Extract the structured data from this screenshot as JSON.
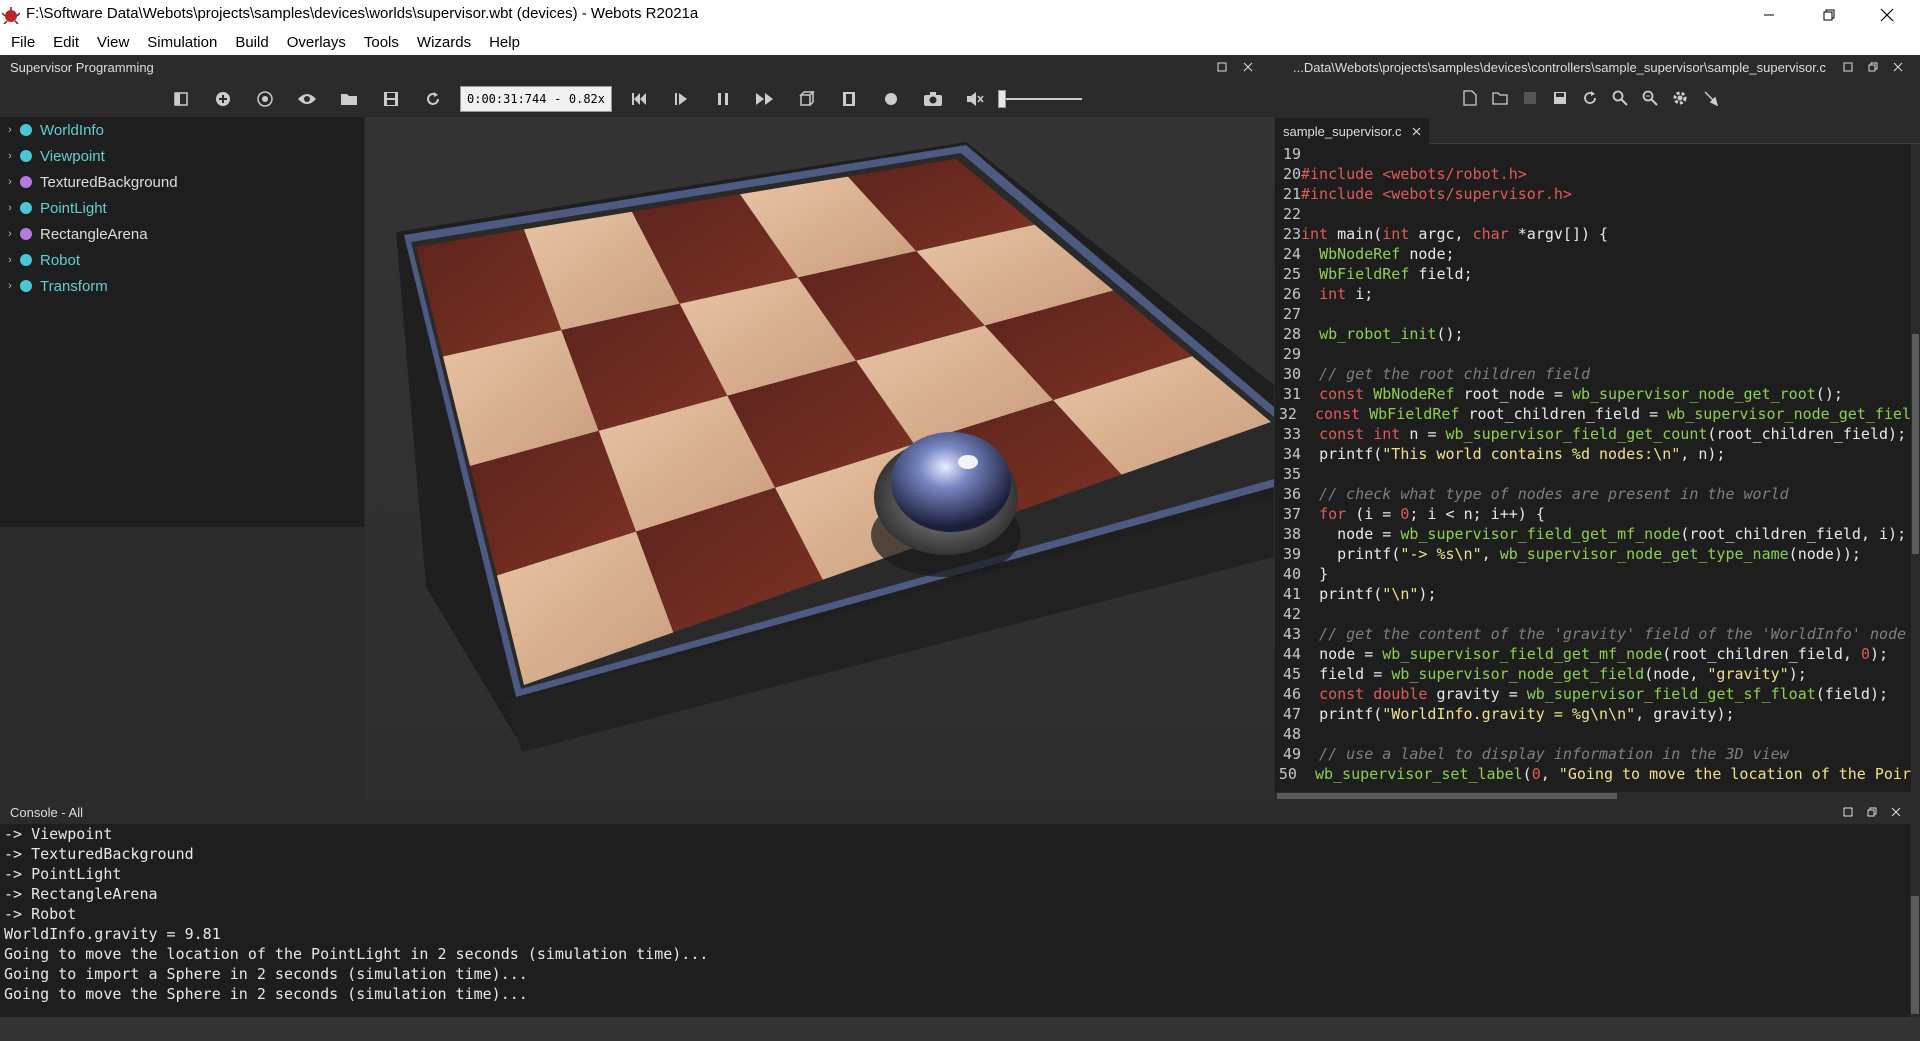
{
  "window": {
    "title": "F:\\Software Data\\Webots\\projects\\samples\\devices\\worlds\\supervisor.wbt (devices) - Webots R2021a",
    "minimize_icon": "minimize-icon",
    "maximize_icon": "restore-icon",
    "close_icon": "close-icon"
  },
  "menu": [
    "File",
    "Edit",
    "View",
    "Simulation",
    "Build",
    "Overlays",
    "Tools",
    "Wizards",
    "Help"
  ],
  "scene_panel": {
    "title": "Supervisor Programming",
    "sim_time": "0:00:31:744",
    "sim_speed": "0.82x",
    "tree": [
      {
        "label": "WorldInfo",
        "color": "#49c6d8",
        "text_color": "#5fd0d0"
      },
      {
        "label": "Viewpoint",
        "color": "#49c6d8",
        "text_color": "#5fd0d0"
      },
      {
        "label": "TexturedBackground",
        "color": "#b57be0",
        "text_color": "#dddddd"
      },
      {
        "label": "PointLight",
        "color": "#49c6d8",
        "text_color": "#5fd0d0"
      },
      {
        "label": "RectangleArena",
        "color": "#b57be0",
        "text_color": "#dddddd"
      },
      {
        "label": "Robot",
        "color": "#49c6d8",
        "text_color": "#5fd0d0"
      },
      {
        "label": "Transform",
        "color": "#49c6d8",
        "text_color": "#5fd0d0"
      }
    ]
  },
  "editor_panel": {
    "title": "...Data\\Webots\\projects\\samples\\devices\\controllers\\sample_supervisor\\sample_supervisor.c",
    "tab": "sample_supervisor.c",
    "lines": [
      {
        "n": "19",
        "code": ""
      },
      {
        "n": "20",
        "code": "#include <webots/robot.h>"
      },
      {
        "n": "21",
        "code": "#include <webots/supervisor.h>"
      },
      {
        "n": "22",
        "code": ""
      },
      {
        "n": "23",
        "code": "int main(int argc, char *argv[]) {"
      },
      {
        "n": "24",
        "code": "  WbNodeRef node;"
      },
      {
        "n": "25",
        "code": "  WbFieldRef field;"
      },
      {
        "n": "26",
        "code": "  int i;"
      },
      {
        "n": "27",
        "code": ""
      },
      {
        "n": "28",
        "code": "  wb_robot_init();"
      },
      {
        "n": "29",
        "code": ""
      },
      {
        "n": "30",
        "code": "  // get the root children field"
      },
      {
        "n": "31",
        "code": "  const WbNodeRef root_node = wb_supervisor_node_get_root();"
      },
      {
        "n": "32",
        "code": "  const WbFieldRef root_children_field = wb_supervisor_node_get_fiel"
      },
      {
        "n": "33",
        "code": "  const int n = wb_supervisor_field_get_count(root_children_field);"
      },
      {
        "n": "34",
        "code": "  printf(\"This world contains %d nodes:\\n\", n);"
      },
      {
        "n": "35",
        "code": ""
      },
      {
        "n": "36",
        "code": "  // check what type of nodes are present in the world"
      },
      {
        "n": "37",
        "code": "  for (i = 0; i < n; i++) {"
      },
      {
        "n": "38",
        "code": "    node = wb_supervisor_field_get_mf_node(root_children_field, i);"
      },
      {
        "n": "39",
        "code": "    printf(\"-> %s\\n\", wb_supervisor_node_get_type_name(node));"
      },
      {
        "n": "40",
        "code": "  }"
      },
      {
        "n": "41",
        "code": "  printf(\"\\n\");"
      },
      {
        "n": "42",
        "code": ""
      },
      {
        "n": "43",
        "code": "  // get the content of the 'gravity' field of the 'WorldInfo' node"
      },
      {
        "n": "44",
        "code": "  node = wb_supervisor_field_get_mf_node(root_children_field, 0);"
      },
      {
        "n": "45",
        "code": "  field = wb_supervisor_node_get_field(node, \"gravity\");"
      },
      {
        "n": "46",
        "code": "  const double gravity = wb_supervisor_field_get_sf_float(field);"
      },
      {
        "n": "47",
        "code": "  printf(\"WorldInfo.gravity = %g\\n\\n\", gravity);"
      },
      {
        "n": "48",
        "code": ""
      },
      {
        "n": "49",
        "code": "  // use a label to display information in the 3D view"
      },
      {
        "n": "50",
        "code": "  wb_supervisor_set_label(0, \"Going to move the location of the Poir"
      }
    ]
  },
  "console": {
    "title": "Console - All",
    "lines": [
      "-> Viewpoint",
      "-> TexturedBackground",
      "-> PointLight",
      "-> RectangleArena",
      "-> Robot",
      "WorldInfo.gravity = 9.81",
      "Going to move the location of the PointLight in 2 seconds (simulation time)...",
      "Going to import a Sphere in 2 seconds (simulation time)...",
      "Going to move the Sphere in 2 seconds (simulation time)..."
    ]
  }
}
